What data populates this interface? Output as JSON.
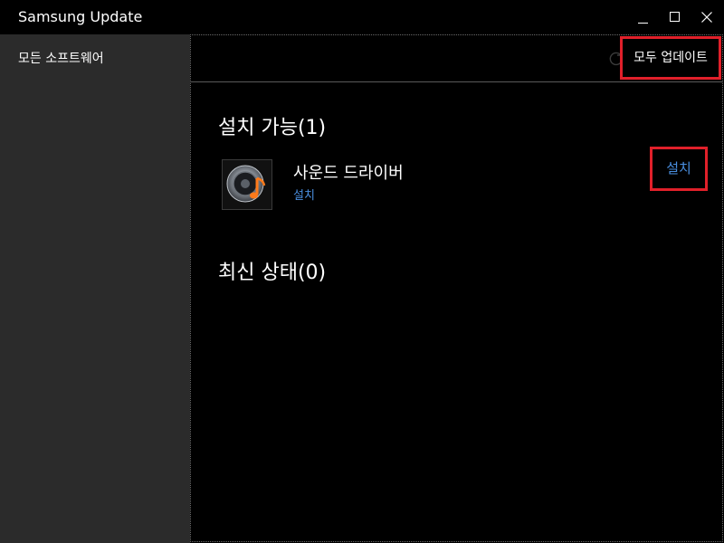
{
  "window": {
    "title": "Samsung Update"
  },
  "sidebar": {
    "items": [
      {
        "label": "모든 소프트웨어"
      }
    ]
  },
  "toolbar": {
    "update_all_label": "모두 업데이트",
    "refresh_icon": "refresh-icon"
  },
  "sections": {
    "available": {
      "title": "설치 가능(1)",
      "items": [
        {
          "name": "사운드 드라이버",
          "status": "설치",
          "action_label": "설치",
          "icon": "speaker-music-icon"
        }
      ]
    },
    "latest": {
      "title": "최신 상태(0)"
    }
  },
  "colors": {
    "background": "#000000",
    "sidebar": "#2b2b2b",
    "link": "#4a8fe0",
    "highlight": "#e0202a"
  }
}
